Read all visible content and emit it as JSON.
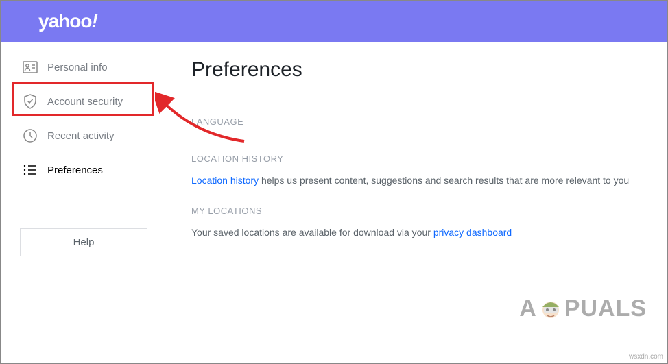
{
  "header": {
    "logo": "yahoo",
    "logo_suffix": "!"
  },
  "sidebar": {
    "items": [
      {
        "label": "Personal info"
      },
      {
        "label": "Account security"
      },
      {
        "label": "Recent activity"
      },
      {
        "label": "Preferences"
      }
    ],
    "help_label": "Help"
  },
  "main": {
    "title": "Preferences",
    "sections": {
      "language": {
        "title": "LANGUAGE"
      },
      "location_history": {
        "title": "LOCATION HISTORY",
        "link_text": "Location history",
        "text_after": " helps us present content, suggestions and search results that are more relevant to you"
      },
      "my_locations": {
        "title": "MY LOCATIONS",
        "text_before": "Your saved locations are available for download via your ",
        "link_text": "privacy dashboard"
      }
    }
  },
  "watermark": {
    "left": "A",
    "right": "PUALS"
  },
  "credit": "wsxdn.com"
}
